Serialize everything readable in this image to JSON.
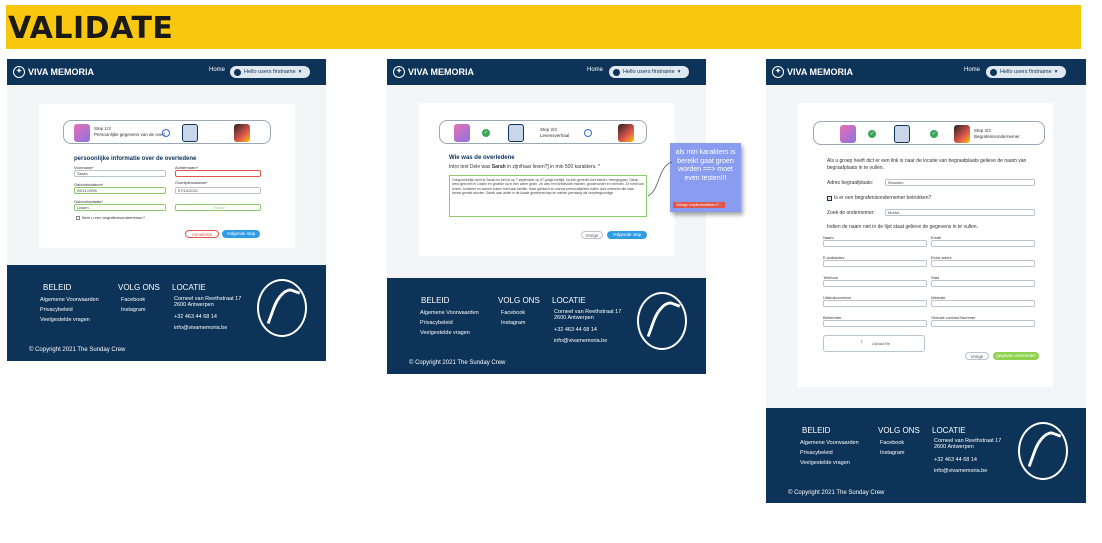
{
  "header": {
    "title": "VALIDATE"
  },
  "brand": {
    "logo_text": "VIVA MEMORIA"
  },
  "nav": {
    "home": "Home",
    "user_menu": "Hello users firstname"
  },
  "footer": {
    "beleid_heading": "BELEID",
    "volg_heading": "VOLG ONS",
    "locatie_heading": "LOCATIE",
    "beleid_links": [
      "Algemene Voorwaarden",
      "Privacybeleid",
      "Veelgestelde vragen"
    ],
    "volg_links": [
      "Facebook",
      "Instagram"
    ],
    "address_line1": "Corneel van Reethstraat 17",
    "address_line2": "2600 Antwerpen",
    "phone": "+32 463 44 68 14",
    "email": "info@vivamemoria.be",
    "copyright": "© Copyright 2021 The Sunday Crew"
  },
  "screen1": {
    "step_title": "Step 1/3",
    "step_sub": "Persoonlijke gegevens van de overl.",
    "section_title": "persoonlijke informatie over de overledene",
    "fields": {
      "voornaam_label": "Voornaam*",
      "voornaam_value": "Sarah",
      "achternaam_label": "Achternaam*",
      "geboortedatum_label": "Geboortedatum*",
      "geboortedatum_value": "09/11/1995",
      "overlijdensdatum_label": "Overlijdensdatum*",
      "overlijdensdatum_value": "07/10/2021",
      "geslacht_label": "Geslacht*",
      "geslacht_value": "Vrouw",
      "geboorteplaats_label": "Geboorteplaats*",
      "geboorteplaats_value": "Lissen"
    },
    "checkbox_label": "Bent u een begrafenisondernemer?",
    "cancel": "Annuleren",
    "next": "Volgende stap"
  },
  "screen2": {
    "step_title": "Step 2/3",
    "step_sub": "Levensverhaal",
    "section_title": "Wie was de overledene",
    "intro_plain": "Intro text Dele was ",
    "intro_bold": "Sarah",
    "intro_rest": " in zijn/haar leven?] in min 500 karakters. *",
    "story": "Oorspronkelijk werd ik Sarah en ben ik op 7 september op 67-jarige leeftijd, na een gevecht met kanker, heengegaan. Sarah werd geboren in Lissen en groeide op in een warm gezin. Ze was een liefdevolle moeder, grootmoeder en vriendin. Ze hield van reizen, tuinieren en samen koken met haar familie. Haar glimlach en warme persoonlijkheid zullen door iedereen die haar kende gemist worden. Sarah was actief in de lokale gemeenschap en werkte jarenlang als verpleegkundige.",
    "back": "Vorige",
    "next": "Volgende stap",
    "sticky_text": "als min karakters is bereikt gaat groen worden ==> moet even testen!!!",
    "sticky_tag": "Design Implementation F..."
  },
  "screen3": {
    "step_title": "Step 3/3",
    "step_sub": "Begrafenisondernemer",
    "intro": "Als u groep heeft dict er een link is naar de locatie van begraafplaats gelieve de naam van begraafplaats in te vullen.",
    "begraafplaats_label": "Adres begraafplaats:",
    "begraafplaats_value": "Wouwen",
    "checkbox_label": "Is er een begrafenisondernemer betrokken?",
    "ondernemer_label": "Zoek de ondernemer:",
    "ondernemer_value": "Morfut",
    "list_hint": "Indien de naam niet in de lijst staat gelieve de gegevens in te vullen.",
    "field_labels": [
      "Naam",
      "Email",
      "E-mailadres",
      "Extra adres",
      "Telefoon",
      "Stad",
      "Uitdrukvoorkeur",
      "Website",
      "Beheerder",
      "Globale contact-Nummer"
    ],
    "upload_label": "Upload file",
    "back": "Vorige",
    "submit": "gegeven verzenden"
  }
}
